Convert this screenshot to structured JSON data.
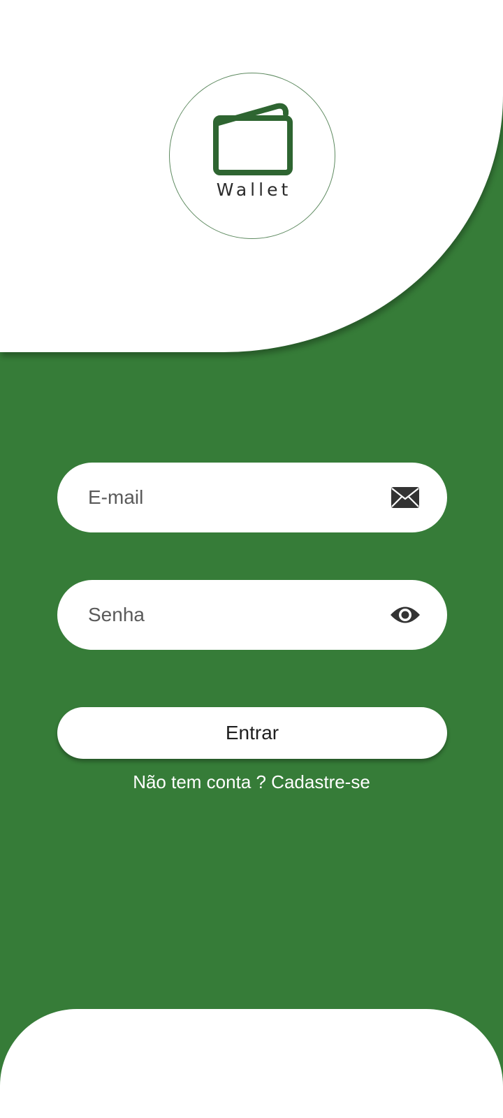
{
  "header": {
    "logo_text": "Wallet",
    "logo_icon": "wallet-icon"
  },
  "form": {
    "email": {
      "placeholder": "E-mail",
      "value": "",
      "icon": "envelope-icon"
    },
    "password": {
      "placeholder": "Senha",
      "value": "",
      "icon": "eye-icon"
    },
    "login_label": "Entrar",
    "signup_text": "Não tem conta ? Cadastre-se"
  },
  "colors": {
    "background": "#367C38",
    "panel": "#FFFFFF",
    "logo_stroke": "#2E6531",
    "icon": "#333333"
  }
}
